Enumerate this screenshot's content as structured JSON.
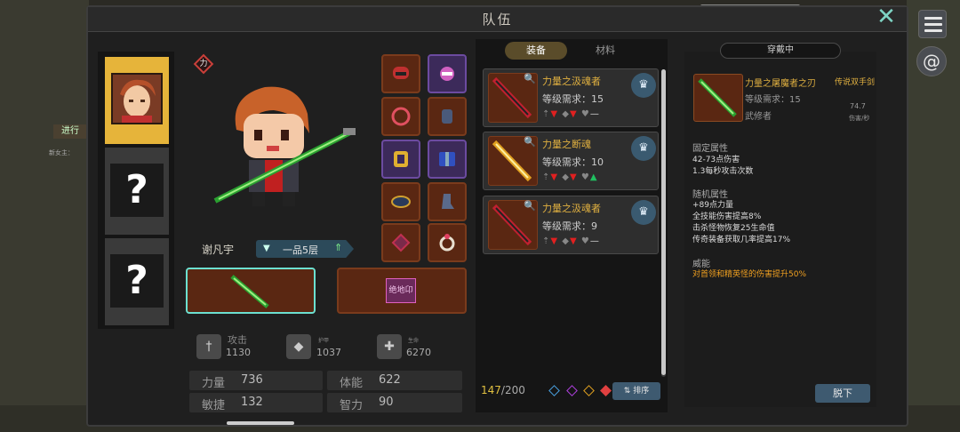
{
  "window": {
    "title": "队伍"
  },
  "tabs": [
    {
      "label": "装备"
    },
    {
      "label": "材料"
    }
  ],
  "character": {
    "name": "谢凡宇",
    "rank": "一品5层",
    "badge": "力"
  },
  "bonus_slot": {
    "label": "绝地卬"
  },
  "stats": {
    "attack": {
      "label": "攻击",
      "value": "1130"
    },
    "armor": {
      "label": "护甲",
      "value": "1037"
    },
    "health": {
      "label": "生命",
      "value": "6270"
    }
  },
  "attributes": [
    {
      "label": "力量",
      "value": "736"
    },
    {
      "label": "体能",
      "value": "622"
    },
    {
      "label": "敏捷",
      "value": "132"
    },
    {
      "label": "智力",
      "value": "90"
    }
  ],
  "items": [
    {
      "name": "力量之汲魂者",
      "req": "等级需求：15"
    },
    {
      "name": "力量之断魂",
      "req": "等级需求：10"
    },
    {
      "name": "力量之汲魂者",
      "req": "等级需求：9"
    }
  ],
  "inventory": {
    "used": "147",
    "total": "/200",
    "sort_label": "排序"
  },
  "equipped": {
    "header": "穿戴中",
    "name": "力量之屠魔者之刃",
    "type": "传说双手剑",
    "req": "等级需求：15",
    "class": "武修者",
    "dps": "74.7",
    "dps_label": "伤害/秒",
    "fixed_title": "固定属性",
    "fixed": [
      "42-73点伤害",
      "1.3每秒攻击次数"
    ],
    "random_title": "随机属性",
    "random": [
      "+89点力量",
      "全技能伤害提高8%",
      "击杀怪物恢复25生命值",
      "传奇装备获取几率提高17%"
    ],
    "power_title": "威能",
    "power": "对首领和精英怪的伤害提升50%",
    "unequip_label": "脱下"
  },
  "left_edge": {
    "tab": "进行",
    "small": "新女主："
  },
  "colors": {
    "accent": "#e0b040",
    "panel": "#1f1f1f",
    "button": "#3e5a70"
  }
}
